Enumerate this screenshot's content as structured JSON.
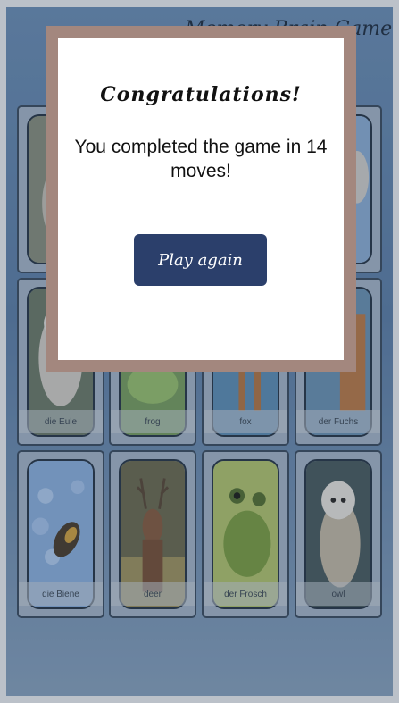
{
  "header": {
    "title": "Memory Brain Game"
  },
  "cards": [
    {
      "caption": ""
    },
    {
      "caption": ""
    },
    {
      "caption": ""
    },
    {
      "caption": ""
    },
    {
      "caption": "die Eule"
    },
    {
      "caption": "frog"
    },
    {
      "caption": "fox"
    },
    {
      "caption": "der Fuchs"
    },
    {
      "caption": "die Biene"
    },
    {
      "caption": "deer"
    },
    {
      "caption": "der Frosch"
    },
    {
      "caption": "owl"
    }
  ],
  "modal": {
    "heading": "Congratulations!",
    "message": "You completed the game in 14 moves!",
    "button_label": "Play again"
  }
}
